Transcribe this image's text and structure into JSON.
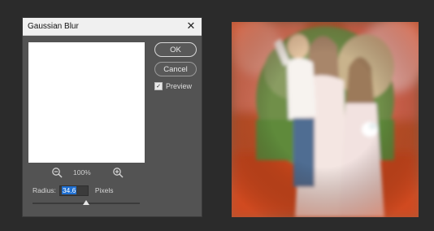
{
  "dialog": {
    "title": "Gaussian Blur",
    "ok_label": "OK",
    "cancel_label": "Cancel",
    "preview_label": "Preview",
    "preview_checked": true,
    "zoom_level": "100%",
    "radius_label": "Radius:",
    "radius_value": "34.6",
    "units_label": "Pixels",
    "radius_slider_fraction": 0.5
  },
  "icons": {
    "close": "close-icon",
    "zoom_out": "zoom-out-icon",
    "zoom_in": "zoom-in-icon",
    "checkmark": "checkmark-icon"
  },
  "colors": {
    "app_background": "#2b2b2b",
    "dialog_background": "#535353",
    "selection_blue": "#1f6fd1",
    "preview_white": "#ffffff"
  }
}
